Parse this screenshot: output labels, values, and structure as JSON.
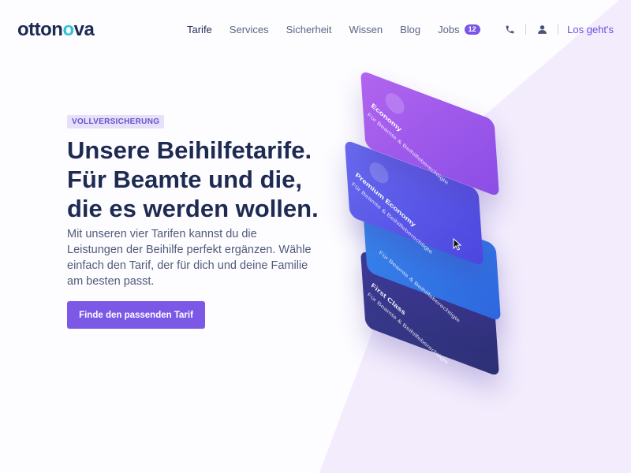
{
  "brand": {
    "logo_text_a": "otton",
    "logo_text_b": "o",
    "logo_text_c": "va"
  },
  "nav": {
    "items": [
      {
        "label": "Tarife"
      },
      {
        "label": "Services"
      },
      {
        "label": "Sicherheit"
      },
      {
        "label": "Wissen"
      },
      {
        "label": "Blog"
      },
      {
        "label": "Jobs",
        "badge": "12"
      }
    ],
    "active": "Tarife"
  },
  "header_actions": {
    "phone_icon": "phone-icon",
    "user_icon": "user-icon",
    "cta_label": "Los geht's"
  },
  "hero": {
    "tag": "VOLLVERSICHERUNG",
    "title_lines": [
      "Unsere Beihilfetarife.",
      "Für Beamte und die,",
      "die es werden wollen."
    ],
    "lead_lines": [
      "Mit unseren vier Tarifen kannst du die",
      "Leistungen der Beihilfe perfekt ergänzen. Wähle",
      "einfach den Tarif, der für dich und deine Familie",
      "am besten passt."
    ],
    "button_label": "Finde den passenden Tarif"
  },
  "cards": [
    {
      "title": "Economy",
      "subtitle": "Für Beamte & Beihilfeberechtigte"
    },
    {
      "title": "Premium Economy",
      "subtitle": "Für Beamte & Beihilfeberechtigte"
    },
    {
      "title": "",
      "subtitle": "Für Beamte & Beihilfeberechtigte"
    },
    {
      "title": "First Class",
      "subtitle": "Für Beamte & Beihilfeberechtigte"
    }
  ],
  "colors": {
    "accent": "#7b59e6",
    "navy": "#1d2a52",
    "logo_accent": "#2ec3d6"
  }
}
